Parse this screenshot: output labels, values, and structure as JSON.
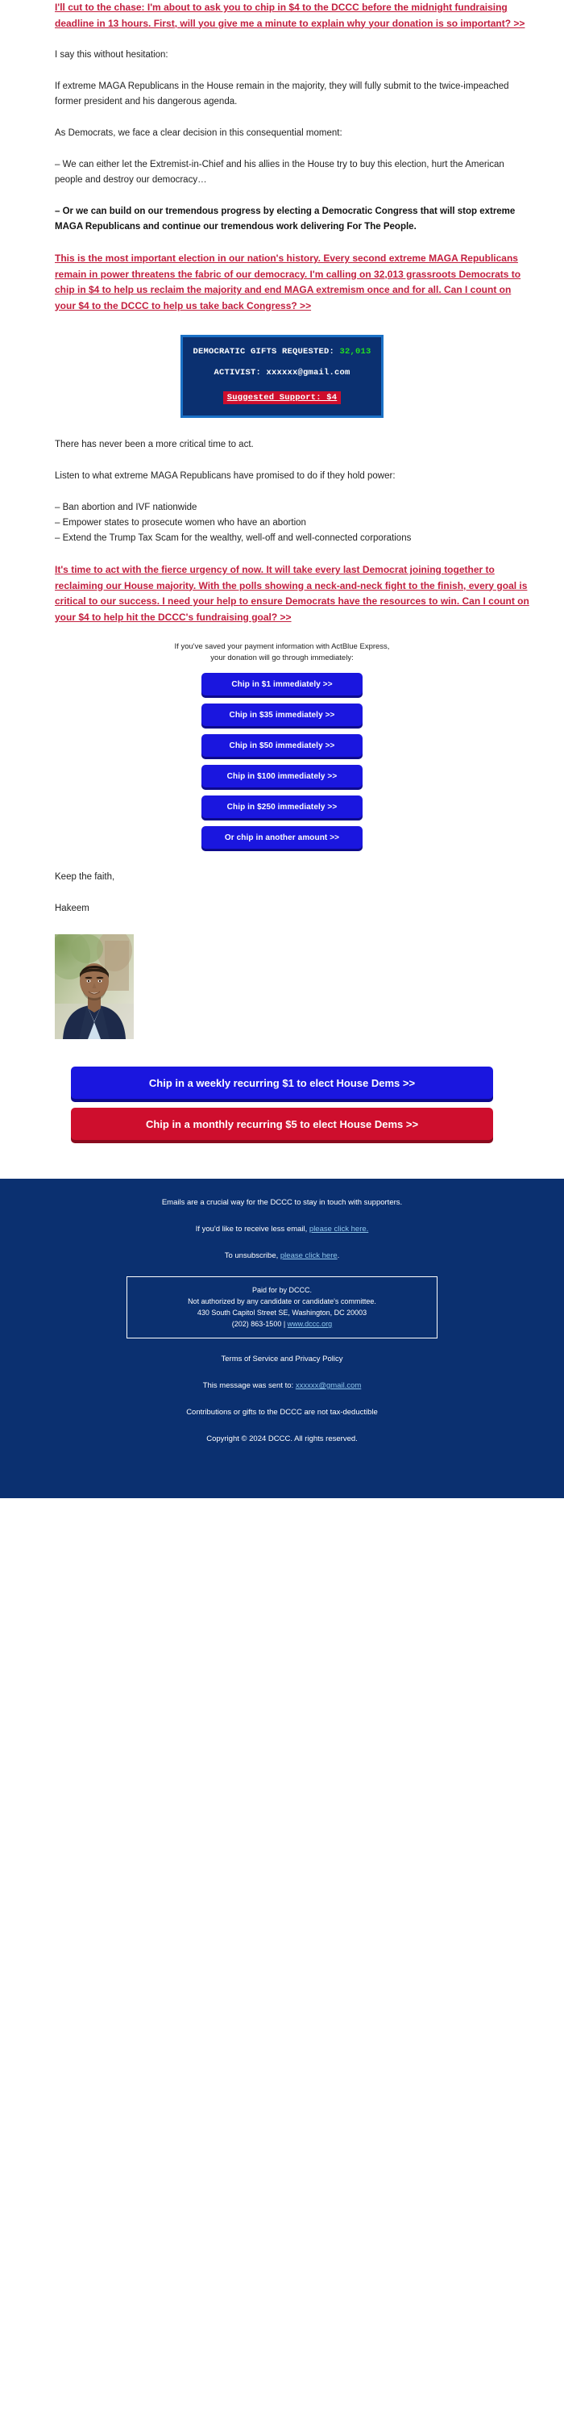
{
  "email": {
    "headline_cta": "I'll cut to the chase: I'm about to ask you to chip in $4 to the DCCC before the midnight fundraising deadline in 13 hours. First, will you give me a minute to explain why your donation is so important? >>",
    "para_1": "I say this without hesitation:",
    "para_2": "If extreme MAGA Republicans in the House remain in the majority, they will fully submit to the twice-impeached former president and his dangerous agenda.",
    "para_3": "As Democrats, we face a clear decision in this consequential moment:",
    "para_4": "– We can either let the Extremist-in-Chief and his allies in the House try to buy this election, hurt the American people and destroy our democracy…",
    "para_5_bold": "– Or we can build on our tremendous progress by electing a Democratic Congress that will stop extreme MAGA Republicans and continue our tremendous work delivering For The People.",
    "cta_2": "This is the most important election in our nation's history. Every second extreme MAGA Republicans remain in power threatens the fabric of our democracy. I'm calling on 32,013 grassroots Democrats to chip in $4 to help us reclaim the majority and end MAGA extremism once and for all. Can I count on your $4 to the DCCC to help us take back Congress? >>",
    "para_6": "There has never been a more critical time to act.",
    "para_7": "Listen to what extreme MAGA Republicans have promised to do if they hold power:",
    "bullets": [
      "– Ban abortion and IVF nationwide",
      "– Empower states to prosecute women who have an abortion",
      "– Extend the Trump Tax Scam for the wealthy, well-off and well-connected corporations"
    ],
    "cta_3": "It's time to act with the fierce urgency of now. It will take every last Democrat joining together to reclaiming our House majority. With the polls showing a neck-and-neck fight to the finish, every goal is critical to our success. I need your help to ensure Democrats have the resources to win. Can I count on your $4 to help hit the DCCC's fundraising goal? >>",
    "closing": "Keep the faith,",
    "signature": "Hakeem"
  },
  "counter": {
    "line1_label": "DEMOCRATIC GIFTS REQUESTED:",
    "line1_value": "32,013",
    "line2": "ACTIVIST: xxxxxx@gmail.com",
    "line3": "Suggested Support: $4",
    "value_color": "#22DD22",
    "box_bg": "#0B3070",
    "box_border": "#1B71C6",
    "highlight_bg": "#CE0E2D"
  },
  "express": {
    "note_line1": "If you've saved your payment information with ActBlue Express,",
    "note_line2": "your donation will go through immediately:",
    "buttons": [
      "Chip in $1 immediately >>",
      "Chip in $35 immediately >>",
      "Chip in $50 immediately >>",
      "Chip in $100 immediately >>",
      "Chip in $250 immediately >>",
      "Or chip in another amount >>"
    ],
    "button_color": "#1A16DF"
  },
  "recurring": {
    "weekly": "Chip in a weekly recurring $1 to elect House Dems >>",
    "monthly": "Chip in a monthly recurring $5 to elect House Dems >>",
    "weekly_color": "#1A16DF",
    "monthly_color": "#CE0E2D"
  },
  "footer": {
    "line_1": "Emails are a crucial way for the DCCC to stay in touch with supporters.",
    "less_email_prefix": "If you'd like to receive less email, ",
    "less_email_link": "please click here.",
    "unsubscribe_prefix": "To unsubscribe, ",
    "unsubscribe_link": "please click here",
    "unsubscribe_suffix": ".",
    "disclaimer_line1": "Paid for by DCCC.",
    "disclaimer_line2": "Not authorized by any candidate or candidate's committee.",
    "disclaimer_line3": "430 South Capitol Street SE, Washington, DC 20003",
    "disclaimer_phone": "(202) 863-1500 | ",
    "disclaimer_url": "www.dccc.org",
    "terms": "Terms of Service and Privacy Policy",
    "sent_to_prefix": "This message was sent to: ",
    "sent_to_email": "xxxxxx@gmail.com",
    "tax": "Contributions or gifts to the DCCC are not tax-deductible",
    "copyright": "Copyright © 2024 DCCC. All rights reserved.",
    "bg_color": "#0B3070",
    "link_color": "#8FC7EE"
  }
}
